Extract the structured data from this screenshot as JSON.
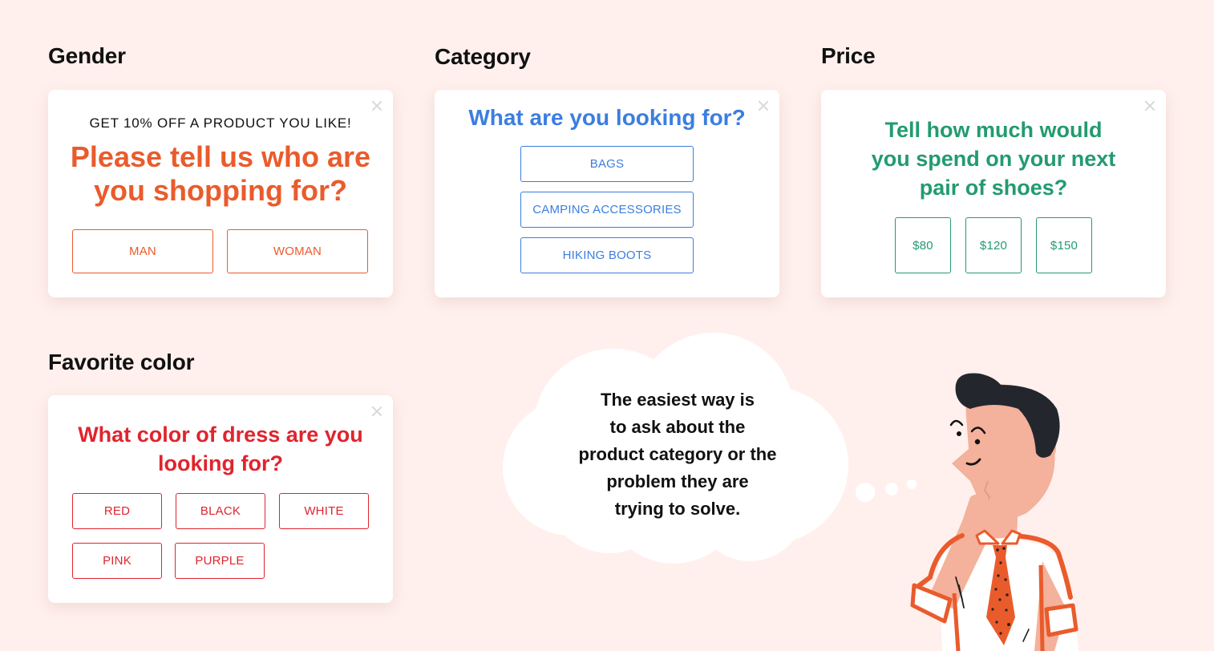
{
  "colors": {
    "background": "#fff0ed",
    "gender_accent": "#ea5b2c",
    "category_accent": "#3b7ee0",
    "price_accent": "#239b6f",
    "color_accent": "#e0242e",
    "close_icon": "#d9d9d9"
  },
  "sections": {
    "gender": {
      "title": "Gender",
      "popup": {
        "subtitle": "GET 10% OFF A PRODUCT YOU LIKE!",
        "heading_line1": "Please tell us who are",
        "heading_line2": "you shopping for?",
        "options": [
          "MAN",
          "WOMAN"
        ],
        "close_icon": "close-icon"
      }
    },
    "category": {
      "title": "Category",
      "popup": {
        "heading": "What are you looking for?",
        "options": [
          "BAGS",
          "CAMPING ACCESSORIES",
          "HIKING BOOTS"
        ],
        "close_icon": "close-icon"
      }
    },
    "price": {
      "title": "Price",
      "popup": {
        "heading_line1": "Tell how much would",
        "heading_line2": "you spend on your next",
        "heading_line3": "pair of shoes?",
        "options": [
          "$80",
          "$120",
          "$150"
        ],
        "close_icon": "close-icon"
      }
    },
    "color": {
      "title": "Favorite color",
      "popup": {
        "heading_line1": "What color of dress are you",
        "heading_line2": "looking for?",
        "options": [
          "RED",
          "BLACK",
          "WHITE",
          "PINK",
          "PURPLE"
        ],
        "close_icon": "close-icon"
      }
    }
  },
  "thought_bubble": {
    "lines": [
      "The easiest way is",
      "to ask about the",
      "product category or the",
      "problem they are",
      "trying to solve."
    ]
  },
  "illustration": {
    "subject": "thinking-man",
    "hair_color": "#23272d",
    "skin_color": "#f4b19b",
    "shirt_accent": "#ea5b2c"
  }
}
